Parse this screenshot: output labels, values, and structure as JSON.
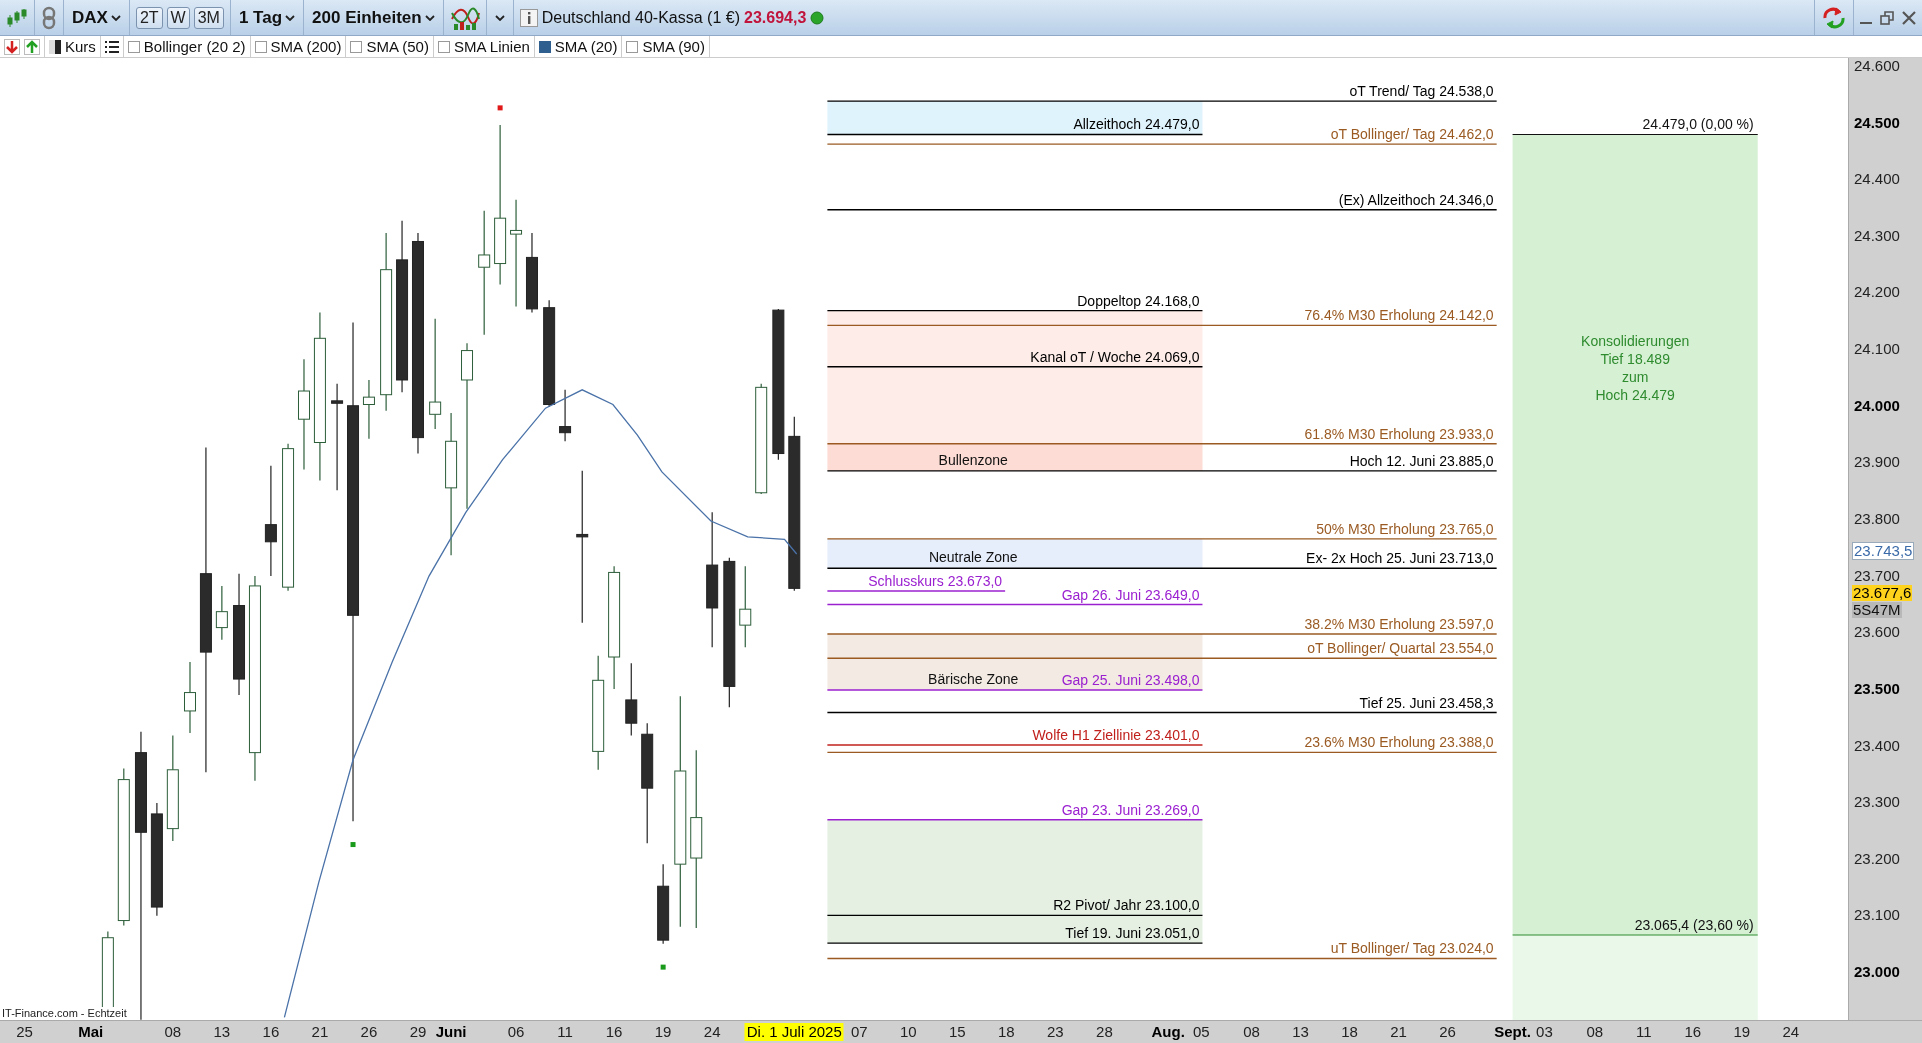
{
  "toolbar": {
    "symbol": "DAX",
    "range_buttons": [
      {
        "label": "2T"
      },
      {
        "label": "W"
      },
      {
        "label": "3M"
      }
    ],
    "interval": "1 Tag",
    "units": "200 Einheiten",
    "instrument": "Deutschland 40-Kassa (1 €)",
    "price": "23.694,3"
  },
  "indicators": {
    "price_label": "Kurs",
    "items": [
      {
        "label": "Bollinger (20 2)",
        "checked": false
      },
      {
        "label": "SMA (200)",
        "checked": false
      },
      {
        "label": "SMA (50)",
        "checked": false
      },
      {
        "label": "SMA Linien",
        "checked": false
      },
      {
        "label": "SMA (20)",
        "checked": true
      },
      {
        "label": "SMA (90)",
        "checked": false
      }
    ]
  },
  "chart": {
    "source": "IT-Finance.com - Echtzeit",
    "levels": [
      {
        "label": "oT Trend/ Tag ",
        "value": "24.538,0",
        "kind": "right",
        "color": "#000000"
      },
      {
        "label": "Allzeithoch",
        "value": "24.479,0",
        "kind": "left",
        "color": "#000000"
      },
      {
        "label": "oT Bollinger/ Tag",
        "value": "24.462,0",
        "kind": "right",
        "color": "#9a5a22"
      },
      {
        "label": "(Ex) Allzeithoch",
        "value": "24.346,0",
        "kind": "right",
        "color": "#000000"
      },
      {
        "label": "Doppeltop",
        "value": "24.168,0",
        "kind": "left",
        "color": "#000000"
      },
      {
        "label": "76.4% M30 Erholung",
        "value": "24.142,0",
        "kind": "right",
        "color": "#9a5a22"
      },
      {
        "label": "Kanal oT / Woche",
        "value": "24.069,0",
        "kind": "left",
        "color": "#000000"
      },
      {
        "label": "61.8% M30 Erholung",
        "value": "23.933,0",
        "kind": "right",
        "color": "#9a5a22"
      },
      {
        "label": "Hoch 12. Juni",
        "value": "23.885,0",
        "kind": "right",
        "color": "#000000"
      },
      {
        "label": "50% M30 Erholung",
        "value": "23.765,0",
        "kind": "right",
        "color": "#9a5a22"
      },
      {
        "label": "Ex- 2x Hoch 25. Juni",
        "value": "23.713,0",
        "kind": "right",
        "color": "#000000"
      },
      {
        "label": "Schlusskurs",
        "value": "23.673,0",
        "kind": "short",
        "color": "#9b20d0"
      },
      {
        "label": "Gap 26. Juni",
        "value": "23.649,0",
        "kind": "left",
        "color": "#9b20d0"
      },
      {
        "label": "38.2% M30 Erholung",
        "value": "23.597,0",
        "kind": "right",
        "color": "#9a5a22"
      },
      {
        "label": "oT Bollinger/ Quartal",
        "value": "23.554,0",
        "kind": "right",
        "color": "#9a5a22"
      },
      {
        "label": "Gap 25. Juni",
        "value": "23.498,0",
        "kind": "left",
        "color": "#9b20d0"
      },
      {
        "label": "Tief 25. Juni",
        "value": "23.458,3",
        "kind": "right",
        "color": "#000000"
      },
      {
        "label": "Wolfe H1 Ziellinie",
        "value": "23.401,0",
        "kind": "left",
        "color": "#c0201c"
      },
      {
        "label": "23.6% M30 Erholung",
        "value": "23.388,0",
        "kind": "right",
        "color": "#9a5a22"
      },
      {
        "label": "Gap 23. Juni",
        "value": "23.269,0",
        "kind": "left",
        "color": "#9b20d0"
      },
      {
        "label": "R2 Pivot/ Jahr",
        "value": "23.100,0",
        "kind": "left",
        "color": "#000000"
      },
      {
        "label": "Tief 19. Juni",
        "value": "23.051,0",
        "kind": "left",
        "color": "#000000"
      },
      {
        "label": "uT Bollinger/ Tag",
        "value": "23.024,0",
        "kind": "right",
        "color": "#9a5a22"
      }
    ],
    "zones": [
      {
        "color": "#dff3fc"
      },
      {
        "color": "#fdece8"
      },
      {
        "label": "Bullenzone",
        "color": "#fcdcd4"
      },
      {
        "label": "Neutrale Zone",
        "color": "#e6edfb"
      },
      {
        "label": "Bärische Zone",
        "color": "#f3ebe3"
      },
      {
        "color": "#e5f0e3"
      }
    ],
    "consolidation": {
      "lines": [
        "Konsolidierungen",
        "Tief 18.489",
        "zum",
        "Hoch 24.479"
      ],
      "top_label": "24.479,0 (0,00 %)",
      "bottom_label": "23.065,4 (23,60 %)"
    }
  },
  "price_axis": {
    "ticks": [
      {
        "label": "24.600",
        "major": false
      },
      {
        "label": "24.500",
        "major": true
      },
      {
        "label": "24.400",
        "major": false
      },
      {
        "label": "24.300",
        "major": false
      },
      {
        "label": "24.200",
        "major": false
      },
      {
        "label": "24.100",
        "major": false
      },
      {
        "label": "24.000",
        "major": true
      },
      {
        "label": "23.900",
        "major": false
      },
      {
        "label": "23.800",
        "major": false
      },
      {
        "label": "23.700",
        "major": false
      },
      {
        "label": "23.600",
        "major": false
      },
      {
        "label": "23.500",
        "major": true
      },
      {
        "label": "23.400",
        "major": false
      },
      {
        "label": "23.300",
        "major": false
      },
      {
        "label": "23.200",
        "major": false
      },
      {
        "label": "23.100",
        "major": false
      },
      {
        "label": "23.000",
        "major": true
      }
    ],
    "markers": [
      {
        "kind": "last",
        "label": "23.743,5"
      },
      {
        "kind": "close",
        "label": "23.677,6"
      },
      {
        "kind": "countdown",
        "label": "5S47M"
      }
    ]
  },
  "date_axis": {
    "labels": [
      {
        "label": "25",
        "kind": "day"
      },
      {
        "label": "Mai",
        "kind": "month"
      },
      {
        "label": "08",
        "kind": "day"
      },
      {
        "label": "13",
        "kind": "day"
      },
      {
        "label": "16",
        "kind": "day"
      },
      {
        "label": "21",
        "kind": "day"
      },
      {
        "label": "26",
        "kind": "day"
      },
      {
        "label": "29",
        "kind": "day"
      },
      {
        "label": "Juni",
        "kind": "month"
      },
      {
        "label": "06",
        "kind": "day"
      },
      {
        "label": "11",
        "kind": "day"
      },
      {
        "label": "16",
        "kind": "day"
      },
      {
        "label": "19",
        "kind": "day"
      },
      {
        "label": "24",
        "kind": "day"
      },
      {
        "label": "Di. 1 Juli 2025",
        "kind": "cursor"
      },
      {
        "label": "07",
        "kind": "day"
      },
      {
        "label": "10",
        "kind": "day"
      },
      {
        "label": "15",
        "kind": "day"
      },
      {
        "label": "18",
        "kind": "day"
      },
      {
        "label": "23",
        "kind": "day"
      },
      {
        "label": "28",
        "kind": "day"
      },
      {
        "label": "Aug.",
        "kind": "month"
      },
      {
        "label": "05",
        "kind": "day"
      },
      {
        "label": "08",
        "kind": "day"
      },
      {
        "label": "13",
        "kind": "day"
      },
      {
        "label": "18",
        "kind": "day"
      },
      {
        "label": "21",
        "kind": "day"
      },
      {
        "label": "26",
        "kind": "day"
      },
      {
        "label": "Sept.",
        "kind": "month"
      },
      {
        "label": "03",
        "kind": "day"
      },
      {
        "label": "08",
        "kind": "day"
      },
      {
        "label": "11",
        "kind": "day"
      },
      {
        "label": "16",
        "kind": "day"
      },
      {
        "label": "19",
        "kind": "day"
      },
      {
        "label": "24",
        "kind": "day"
      }
    ]
  }
}
